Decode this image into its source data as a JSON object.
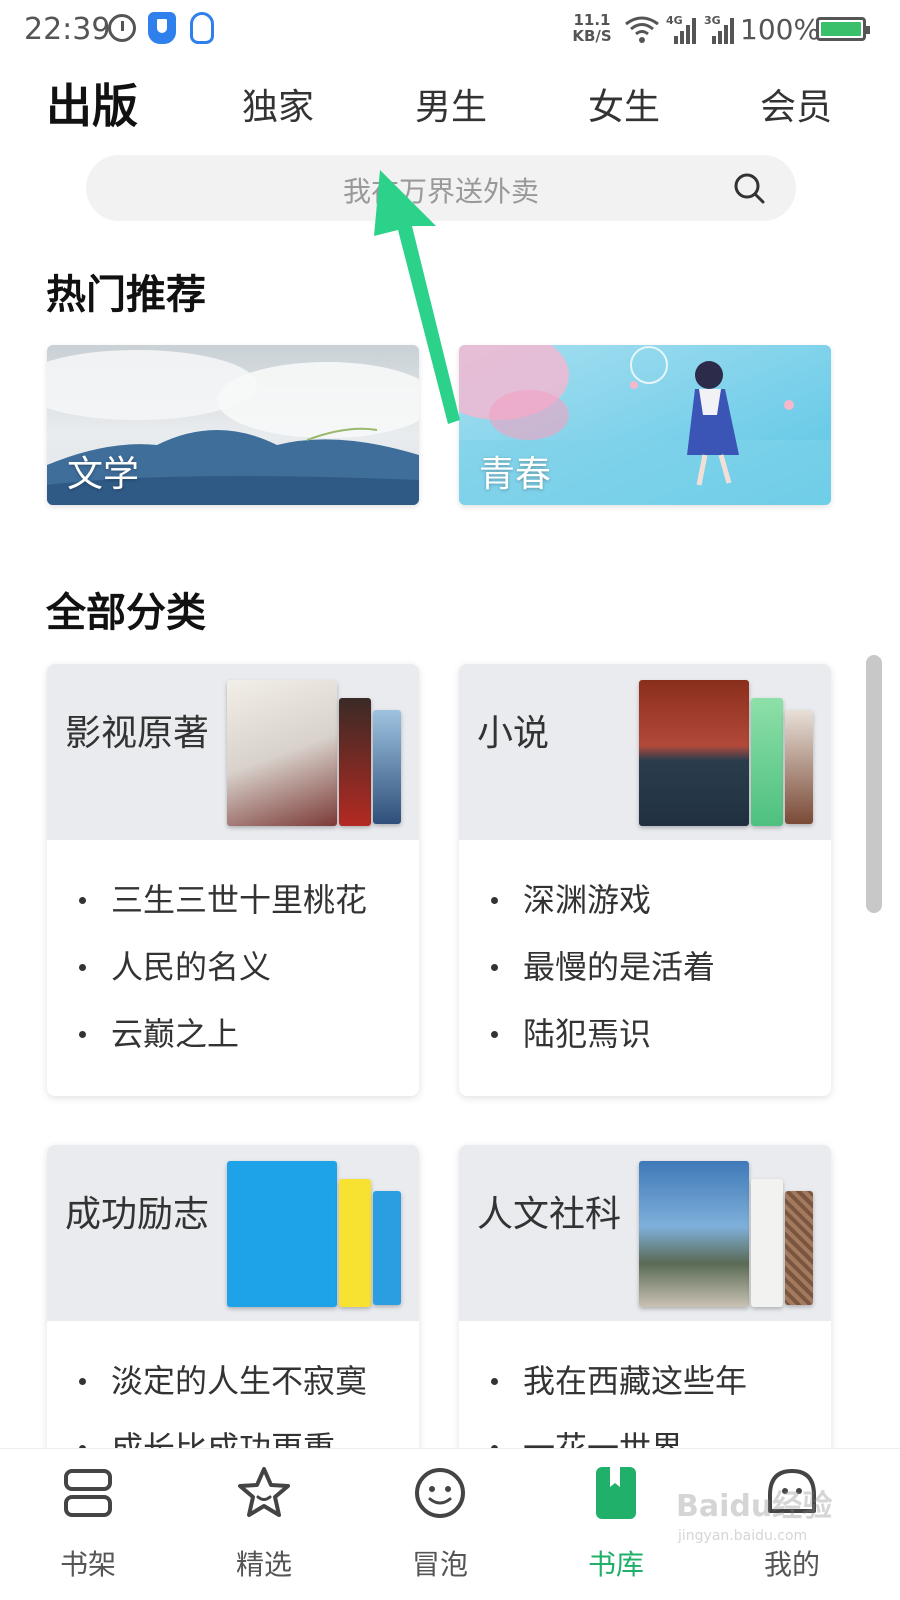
{
  "status_bar": {
    "time": "22:39",
    "net_speed_value": "11.1",
    "net_speed_unit": "KB/S",
    "net_4g": "4G",
    "net_3g": "3G",
    "battery": "100%",
    "battery_level": 1.0
  },
  "top_nav": {
    "active": "出版",
    "tabs": [
      "独家",
      "男生",
      "女生",
      "会员"
    ]
  },
  "search": {
    "placeholder": "我在万界送外卖"
  },
  "hot": {
    "title": "热门推荐",
    "cards": [
      {
        "label": "文学"
      },
      {
        "label": "青春"
      }
    ]
  },
  "categories": {
    "title": "全部分类",
    "cards": [
      {
        "title": "影视原著",
        "items": [
          "三生三世十里桃花",
          "人民的名义",
          "云巅之上"
        ]
      },
      {
        "title": "小说",
        "items": [
          "深渊游戏",
          "最慢的是活着",
          "陆犯焉识"
        ]
      },
      {
        "title": "成功励志",
        "items": [
          "淡定的人生不寂寞",
          "成长比成功更重…"
        ]
      },
      {
        "title": "人文社科",
        "items": [
          "我在西藏这些年",
          "一花一世界"
        ]
      }
    ]
  },
  "bottom_nav": {
    "items": [
      {
        "label": "书架",
        "icon": "bookshelf-icon"
      },
      {
        "label": "精选",
        "icon": "star-icon"
      },
      {
        "label": "冒泡",
        "icon": "smile-icon"
      },
      {
        "label": "书库",
        "icon": "book-icon"
      },
      {
        "label": "我的",
        "icon": "profile-icon"
      }
    ],
    "active_index": 3
  },
  "colors": {
    "accent": "#21b06a",
    "arrow": "#2dd28a"
  },
  "watermark": {
    "brand": "Baidu经验",
    "url": "jingyan.baidu.com"
  }
}
